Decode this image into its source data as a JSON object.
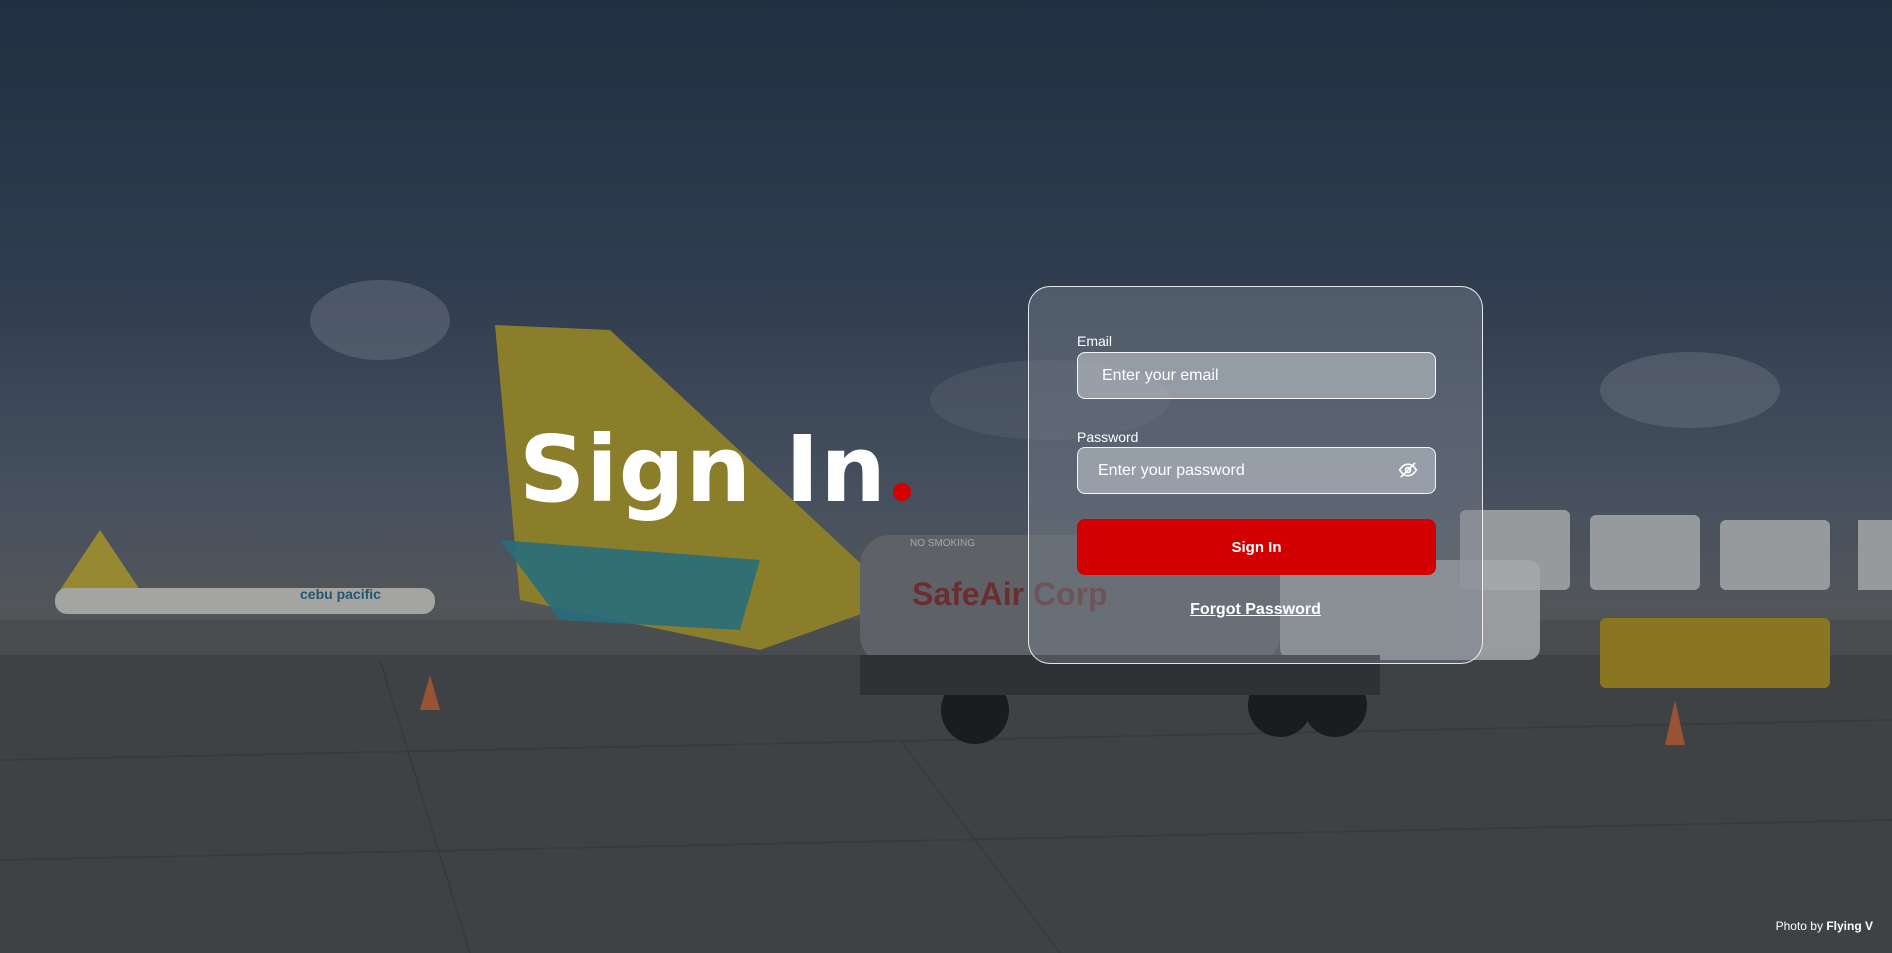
{
  "hero": {
    "title": "Sign In"
  },
  "form": {
    "email_label": "Email",
    "email_placeholder": "Enter your email",
    "password_label": "Password",
    "password_placeholder": "Enter your password",
    "submit_label": "Sign In",
    "forgot_label": "Forgot Password"
  },
  "photo_credit": {
    "prefix": "Photo by",
    "author": "Flying V"
  },
  "background": {
    "truck_text": "SafeAir Corp",
    "truck_sign": "NO SMOKING",
    "aircraft_livery": "cebu pacific"
  },
  "colors": {
    "accent": "#d20000",
    "accent_dot": "#d40000"
  },
  "icons": {
    "password_toggle": "eye-off-icon"
  }
}
